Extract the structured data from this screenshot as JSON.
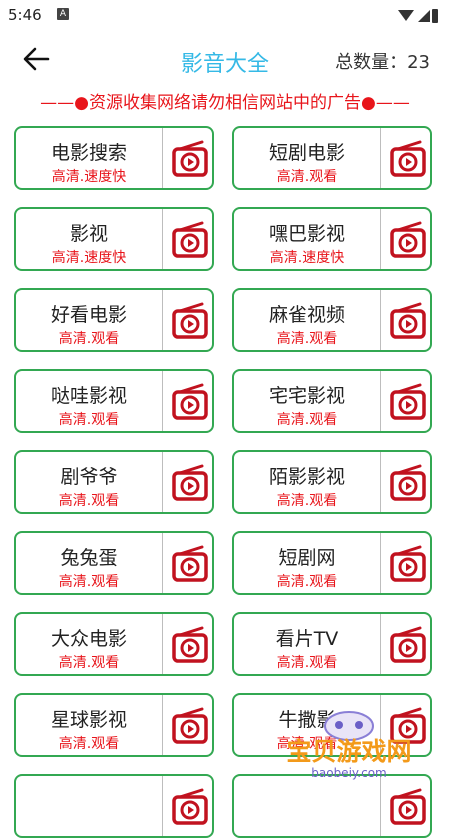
{
  "status_bar": {
    "time": "5:46",
    "app_icon": "A"
  },
  "header": {
    "title": "影音大全",
    "count_label": "总数量：",
    "count_value": "23"
  },
  "notice": "——●资源收集网络请勿相信网站中的广告●——",
  "items": [
    {
      "name": "电影搜索",
      "sub": "高清.速度快"
    },
    {
      "name": "短剧电影",
      "sub": "高清.观看"
    },
    {
      "name": "影视",
      "sub": "高清.速度快"
    },
    {
      "name": "嘿巴影视",
      "sub": "高清.速度快"
    },
    {
      "name": "好看电影",
      "sub": "高清.观看"
    },
    {
      "name": "麻雀视频",
      "sub": "高清.观看"
    },
    {
      "name": "哒哇影视",
      "sub": "高清.观看"
    },
    {
      "name": "宅宅影视",
      "sub": "高清.观看"
    },
    {
      "name": "剧爷爷",
      "sub": "高清.观看"
    },
    {
      "name": "陌影影视",
      "sub": "高清.观看"
    },
    {
      "name": "兔兔蛋",
      "sub": "高清.观看"
    },
    {
      "name": "短剧网",
      "sub": "高清.观看"
    },
    {
      "name": "大众电影",
      "sub": "高清.观看"
    },
    {
      "name": "看片TV",
      "sub": "高清.观看"
    },
    {
      "name": "星球影视",
      "sub": "高清.观看"
    },
    {
      "name": "牛撒影",
      "sub": "高清.观看"
    },
    {
      "name": "",
      "sub": ""
    },
    {
      "name": "",
      "sub": ""
    }
  ],
  "icons": {
    "back": "back-arrow-icon",
    "play": "play-tv-icon"
  },
  "colors": {
    "accent": "#35b9e6",
    "border": "#33a852",
    "red": "#e8151b",
    "icon_red": "#c1121f"
  },
  "watermark": {
    "text": "宝贝游戏网",
    "url": "baobeiy.com"
  }
}
